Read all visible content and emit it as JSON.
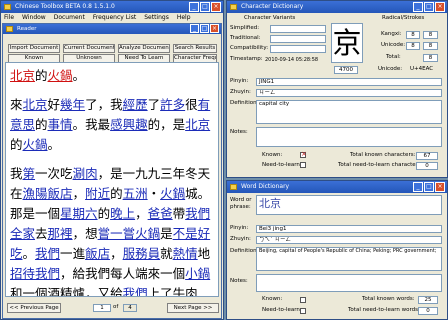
{
  "reader_app": {
    "title": "Chinese Toolbox BETA 0.8 1.5.1.0",
    "menu": [
      "File",
      "Window",
      "Document",
      "Frequency List",
      "Settings",
      "Help"
    ]
  },
  "reader": {
    "title": "Reader",
    "buttons_row1": [
      "Import Document",
      "Current Document",
      "Analyze Document",
      "Search Results"
    ],
    "buttons_row2": [
      "Known",
      "Unknown",
      "Need To Learn",
      "Character Frequency"
    ],
    "prev_label": "<< Previous Page",
    "page_current": "1",
    "page_of": "of",
    "page_total": "4",
    "next_label": "Next Page >>",
    "paragraphs": [
      [
        {
          "t": "北京",
          "c": "r"
        },
        {
          "t": "的",
          "c": ""
        },
        {
          "t": "火鍋",
          "c": "r"
        },
        {
          "t": "。",
          "c": ""
        }
      ],
      [
        {
          "t": "來",
          "c": ""
        },
        {
          "t": "北京",
          "c": "b"
        },
        {
          "t": "好",
          "c": ""
        },
        {
          "t": "幾年",
          "c": "b"
        },
        {
          "t": "了，",
          "c": ""
        },
        {
          "t": "我",
          "c": ""
        },
        {
          "t": "經歷",
          "c": "b"
        },
        {
          "t": "了",
          "c": ""
        },
        {
          "t": "許多",
          "c": "b"
        },
        {
          "t": "很",
          "c": ""
        },
        {
          "t": "有意思",
          "c": "b"
        },
        {
          "t": "的",
          "c": ""
        },
        {
          "t": "事情",
          "c": "b"
        },
        {
          "t": "。",
          "c": ""
        },
        {
          "t": "我",
          "c": ""
        },
        {
          "t": "最",
          "c": ""
        },
        {
          "t": "感興趣",
          "c": "b"
        },
        {
          "t": "的，",
          "c": ""
        },
        {
          "t": "是",
          "c": ""
        },
        {
          "t": "北京",
          "c": "b"
        },
        {
          "t": "的",
          "c": ""
        },
        {
          "t": "火鍋",
          "c": "b"
        },
        {
          "t": "。",
          "c": ""
        }
      ],
      [
        {
          "t": "我",
          "c": ""
        },
        {
          "t": "第",
          "c": "b"
        },
        {
          "t": "一次",
          "c": ""
        },
        {
          "t": "吃",
          "c": ""
        },
        {
          "t": "涮肉",
          "c": "b"
        },
        {
          "t": "，",
          "c": ""
        },
        {
          "t": "是",
          "c": ""
        },
        {
          "t": "一九九三年",
          "c": ""
        },
        {
          "t": "冬天",
          "c": ""
        },
        {
          "t": "在",
          "c": ""
        },
        {
          "t": "漁陽",
          "c": "b"
        },
        {
          "t": "飯店",
          "c": "b"
        },
        {
          "t": "，",
          "c": ""
        },
        {
          "t": "附近",
          "c": "b"
        },
        {
          "t": "的",
          "c": ""
        },
        {
          "t": "五洲",
          "c": "b"
        },
        {
          "t": "‧",
          "c": ""
        },
        {
          "t": "火鍋",
          "c": "b"
        },
        {
          "t": "城",
          "c": ""
        },
        {
          "t": "。",
          "c": ""
        },
        {
          "t": "那",
          "c": ""
        },
        {
          "t": "是",
          "c": ""
        },
        {
          "t": "一個",
          "c": ""
        },
        {
          "t": "星期六",
          "c": "b"
        },
        {
          "t": "的",
          "c": ""
        },
        {
          "t": "晚上",
          "c": "b"
        },
        {
          "t": "，",
          "c": ""
        },
        {
          "t": "爸爸",
          "c": "b"
        },
        {
          "t": "帶",
          "c": ""
        },
        {
          "t": "我們",
          "c": "b"
        },
        {
          "t": "全家",
          "c": "b"
        },
        {
          "t": "去",
          "c": ""
        },
        {
          "t": "那裡",
          "c": "b"
        },
        {
          "t": "，",
          "c": ""
        },
        {
          "t": "想",
          "c": ""
        },
        {
          "t": "嘗一嘗",
          "c": "b"
        },
        {
          "t": "火鍋",
          "c": "b"
        },
        {
          "t": "是",
          "c": ""
        },
        {
          "t": "不是",
          "c": "b"
        },
        {
          "t": "好吃",
          "c": "b"
        },
        {
          "t": "。",
          "c": ""
        },
        {
          "t": "我們",
          "c": "b"
        },
        {
          "t": "一",
          "c": ""
        },
        {
          "t": "進",
          "c": ""
        },
        {
          "t": "飯店",
          "c": "b"
        },
        {
          "t": "，",
          "c": ""
        },
        {
          "t": "服務員",
          "c": "b"
        },
        {
          "t": "就",
          "c": ""
        },
        {
          "t": "熱情",
          "c": "b"
        },
        {
          "t": "地",
          "c": ""
        },
        {
          "t": "招待",
          "c": "b"
        },
        {
          "t": "我們",
          "c": "b"
        },
        {
          "t": "，",
          "c": ""
        },
        {
          "t": "給",
          "c": ""
        },
        {
          "t": "我們",
          "c": ""
        },
        {
          "t": "每人",
          "c": ""
        },
        {
          "t": "端",
          "c": ""
        },
        {
          "t": "來",
          "c": ""
        },
        {
          "t": "一個",
          "c": ""
        },
        {
          "t": "小鍋",
          "c": "b"
        },
        {
          "t": "和",
          "c": ""
        },
        {
          "t": "一個",
          "c": ""
        },
        {
          "t": "酒",
          "c": ""
        },
        {
          "t": "精爐",
          "c": ""
        },
        {
          "t": "，",
          "c": ""
        },
        {
          "t": "又",
          "c": ""
        },
        {
          "t": "給",
          "c": ""
        },
        {
          "t": "我們",
          "c": "b"
        },
        {
          "t": "上",
          "c": ""
        },
        {
          "t": "了",
          "c": ""
        },
        {
          "t": "牛肉片",
          "c": ""
        },
        {
          "t": "、",
          "c": ""
        }
      ]
    ]
  },
  "char_dict": {
    "title": "Character Dictionary",
    "variants_label": "Character Variants",
    "radical_label": "Radical/Strokes",
    "simplified_label": "Simplified:",
    "traditional_label": "Traditional:",
    "compatibility_label": "Compatibility:",
    "timestamp_label": "Timestamp:",
    "timestamp_value": "2010-09-14 05:28:58",
    "character": "京",
    "count_value": "4700",
    "kangxi_label": "Kangxi:",
    "kangxi_value": "8",
    "unicode_label": "Unicode:",
    "unicode_value": "8",
    "total_label": "Total:",
    "total_value": "8",
    "unicode_code_label": "Unicode:",
    "unicode_code_value": "U+4EAC",
    "pinyin_label": "Pinyin:",
    "pinyin_value": "JING1",
    "zhuyin_label": "Zhuyin:",
    "zhuyin_value": "ㄐㄧㄥ",
    "definition_label": "Definition:",
    "definition_value": "capital city",
    "notes_label": "Notes:",
    "known_label": "Known:",
    "need_label": "Need-to-learn:",
    "total_known_label": "Total known characters:",
    "total_known_value": "67",
    "total_need_label": "Total need-to-learn characters:",
    "total_need_value": "0"
  },
  "word_dict": {
    "title": "Word Dictionary",
    "word_label": "Word or phrase:",
    "word_value": "北京",
    "pinyin_label": "Pinyin:",
    "pinyin_value": "Bei3 jing1",
    "zhuyin_label": "Zhuyin:",
    "zhuyin_value": "ㄅㄟˇ ㄐㄧㄥ",
    "definition_label": "Definition:",
    "definition_value": "Beijing, capital of People's Republic of China; Peking; PRC government;",
    "notes_label": "Notes:",
    "known_label": "Known:",
    "need_label": "Need-to-learn:",
    "total_known_label": "Total known words:",
    "total_known_value": "25",
    "total_need_label": "Total need-to-learn words:",
    "total_need_value": "0"
  }
}
